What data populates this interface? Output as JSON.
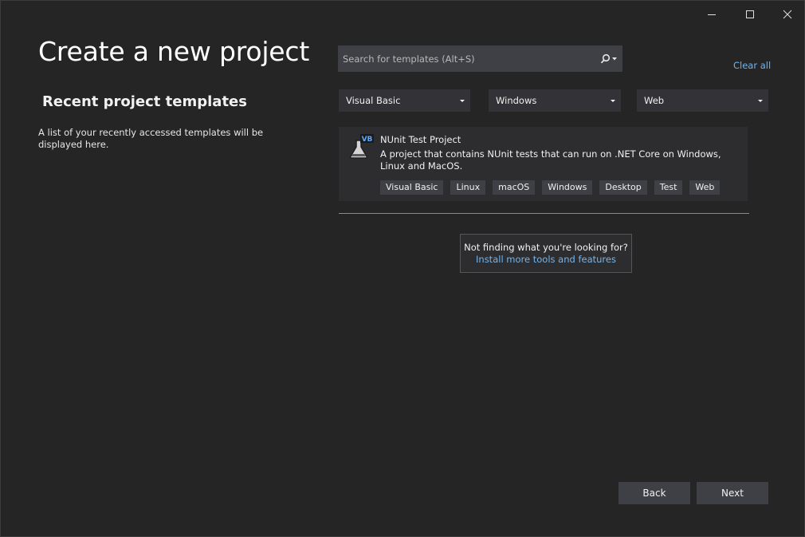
{
  "window_controls": {
    "minimize": "minimize-icon",
    "maximize": "maximize-icon",
    "close": "close-icon"
  },
  "page": {
    "title": "Create a new project"
  },
  "recent": {
    "heading": "Recent project templates",
    "description": "A list of your recently accessed templates will be displayed here."
  },
  "search": {
    "placeholder": "Search for templates (Alt+S)",
    "value": "",
    "icon": "search-icon",
    "clear_all": "Clear all"
  },
  "filters": {
    "language": "Visual Basic",
    "platform": "Windows",
    "project_type": "Web"
  },
  "templates": [
    {
      "name": "NUnit Test Project",
      "description": "A project that contains NUnit tests that can run on .NET Core on Windows, Linux and MacOS.",
      "icon": "vb-test-flask-icon",
      "icon_badge": "VB",
      "tags": [
        "Visual Basic",
        "Linux",
        "macOS",
        "Windows",
        "Desktop",
        "Test",
        "Web"
      ]
    }
  ],
  "not_finding": {
    "text": "Not finding what you're looking for?",
    "link": "Install more tools and features"
  },
  "footer": {
    "back": "Back",
    "next": "Next"
  },
  "colors": {
    "background": "#252526",
    "card": "#2d2d30",
    "control": "#3f3f46",
    "link": "#74b4ea",
    "text": "#f1f1f1"
  }
}
